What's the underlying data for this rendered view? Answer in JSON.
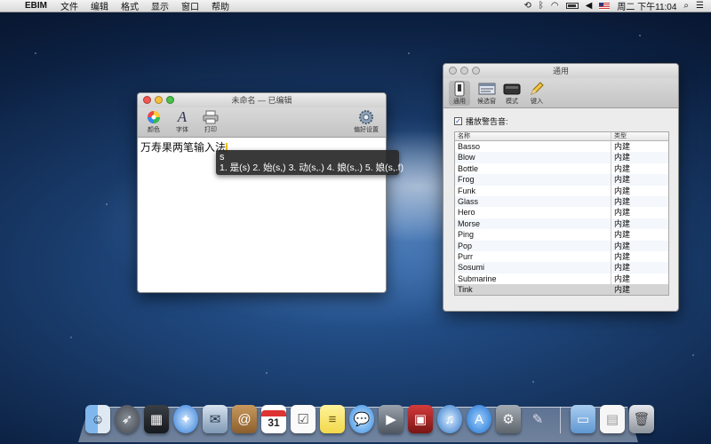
{
  "menubar": {
    "app_name": "EBIM",
    "items": [
      "文件",
      "编辑",
      "格式",
      "显示",
      "窗口",
      "帮助"
    ],
    "clock": "周二 下午11:04"
  },
  "editor": {
    "title": "未命名",
    "title_status": "— 已编辑",
    "toolbar": {
      "colors_label": "颜色",
      "fonts_label": "字体",
      "print_label": "打印",
      "prefs_label": "偏好设置"
    },
    "text": "万寿果两笔输入法"
  },
  "candidate_panel": {
    "input_code": "s",
    "candidates": "1. 是(s) 2. 始(s,) 3. 动(s,.) 4. 娘(s,.) 5. 娘(s,.f)"
  },
  "prefs": {
    "title": "通用",
    "toolbar": {
      "general_label": "通用",
      "candidate_label": "候选窗",
      "mode_label": "模式",
      "learn_label": "键入"
    },
    "play_sound_label": "播放警告音:",
    "play_sound_checked": true,
    "table": {
      "col_name": "名称",
      "col_type": "类型",
      "rows": [
        {
          "name": "Basso",
          "type": "内建"
        },
        {
          "name": "Blow",
          "type": "内建"
        },
        {
          "name": "Bottle",
          "type": "内建"
        },
        {
          "name": "Frog",
          "type": "内建"
        },
        {
          "name": "Funk",
          "type": "内建"
        },
        {
          "name": "Glass",
          "type": "内建"
        },
        {
          "name": "Hero",
          "type": "内建"
        },
        {
          "name": "Morse",
          "type": "内建"
        },
        {
          "name": "Ping",
          "type": "内建"
        },
        {
          "name": "Pop",
          "type": "内建"
        },
        {
          "name": "Purr",
          "type": "内建"
        },
        {
          "name": "Sosumi",
          "type": "内建"
        },
        {
          "name": "Submarine",
          "type": "内建"
        },
        {
          "name": "Tink",
          "type": "内建"
        }
      ],
      "selected_row": "Tink"
    }
  },
  "dock": {
    "calendar_day": "31",
    "icons": [
      "finder-icon",
      "launchpad-icon",
      "mission-control-icon",
      "safari-icon",
      "mail-icon",
      "contacts-icon",
      "calendar-icon",
      "reminders-icon",
      "notes-icon",
      "messages-icon",
      "facetime-icon",
      "photo-booth-icon",
      "itunes-icon",
      "app-store-icon",
      "system-preferences-icon",
      "textedit-icon",
      "folder-icon",
      "document-icon",
      "trash-icon"
    ]
  }
}
